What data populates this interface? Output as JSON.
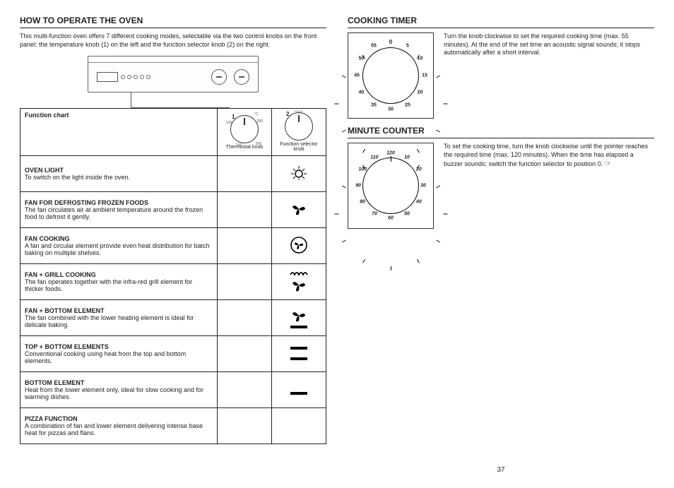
{
  "page": "37",
  "left": {
    "title": "HOW TO OPERATE THE OVEN",
    "intro": "This multi-function oven offers 7 different cooking modes, selectable via the two control knobs on the front panel: the temperature knob (1) on the left and the function selector knob (2) on the right.",
    "table_header": "Function chart",
    "col1_header": "Thermostat knob",
    "col2_header": "Function selector knob",
    "num1": "1",
    "num2": "2",
    "rows": [
      {
        "name": "OVEN LIGHT",
        "desc": "To switch on the light inside the oven."
      },
      {
        "name": "FAN FOR DEFROSTING FROZEN FOODS",
        "desc": "The fan circulates air at ambient temperature around the frozen food to defrost it gently."
      },
      {
        "name": "FAN COOKING",
        "desc": "A fan and circular element provide even heat distribution for batch baking on multiple shelves."
      },
      {
        "name": "FAN + GRILL COOKING",
        "desc": "The fan operates together with the infra‑red grill element for thicker foods."
      },
      {
        "name": "FAN + BOTTOM ELEMENT",
        "desc": "The fan combined with the lower heating element is ideal for delicate baking."
      },
      {
        "name": "TOP + BOTTOM ELEMENTS",
        "desc": "Conventional cooking using heat from the top and bottom elements."
      },
      {
        "name": "BOTTOM ELEMENT",
        "desc": "Heat from the lower element only, ideal for slow cooking and for warming dishes."
      },
      {
        "name": "PIZZA FUNCTION",
        "desc": "A combination of fan and lower element delivering intense base heat for pizzas and flans."
      }
    ]
  },
  "right": {
    "title1": "COOKING TIMER",
    "text1": "Turn the knob clockwise to set the required cooking time (max. 55 minutes). At the end of the set time an acoustic signal sounds; it stops automatically after a short interval.",
    "timer_ticks": [
      "0",
      "5",
      "10",
      "15",
      "20",
      "25",
      "30",
      "35",
      "40",
      "45",
      "50",
      "55"
    ],
    "title2": "MINUTE COUNTER",
    "text2": "To set the cooking time, turn the knob clockwise until the pointer reaches the required time (max. 120 minutes). When the time has elapsed a buzzer sounds; switch the function selector to position 0.",
    "counter_ticks": [
      "10",
      "20",
      "30",
      "40",
      "50",
      "60",
      "70",
      "80",
      "90",
      "100",
      "110",
      "120"
    ],
    "hand_icon": "☞"
  }
}
